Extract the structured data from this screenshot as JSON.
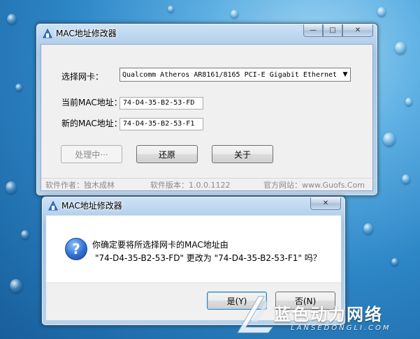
{
  "main_window": {
    "title": "MAC地址修改器",
    "nic_label": "选择网卡：",
    "nic_selected": "Qualcomm Atheros AR8161/8165 PCI-E Gigabit Ethernet",
    "current_mac_label": "当前MAC地址：",
    "current_mac_value": "74-D4-35-B2-53-FD",
    "new_mac_label": "新的MAC地址：",
    "new_mac_value": "74-D4-35-B2-53-F1",
    "process_button": "处理中···",
    "restore_button": "还原",
    "about_button": "关于",
    "status_author": "软件作者：独木成林",
    "status_version": "软件版本：1.0.0.1122",
    "status_website": "官方网站：www.Guofs.Com"
  },
  "dialog": {
    "title": "MAC地址修改器",
    "message_line1": "你确定要将所选择网卡的MAC地址由",
    "message_line2": "\"74-D4-35-B2-53-FD\" 更改为 \"74-D4-35-B2-53-F1\" 吗？",
    "yes_button": "是(Y)",
    "no_button": "否(N)"
  },
  "watermark": {
    "brand": "蓝色动力网络",
    "domain": "LANSEDONGLI.COM"
  },
  "icons": {
    "app": "app-icon",
    "question": "question-icon",
    "minimize": "minimize-icon",
    "maximize": "maximize-icon",
    "close": "close-icon"
  }
}
